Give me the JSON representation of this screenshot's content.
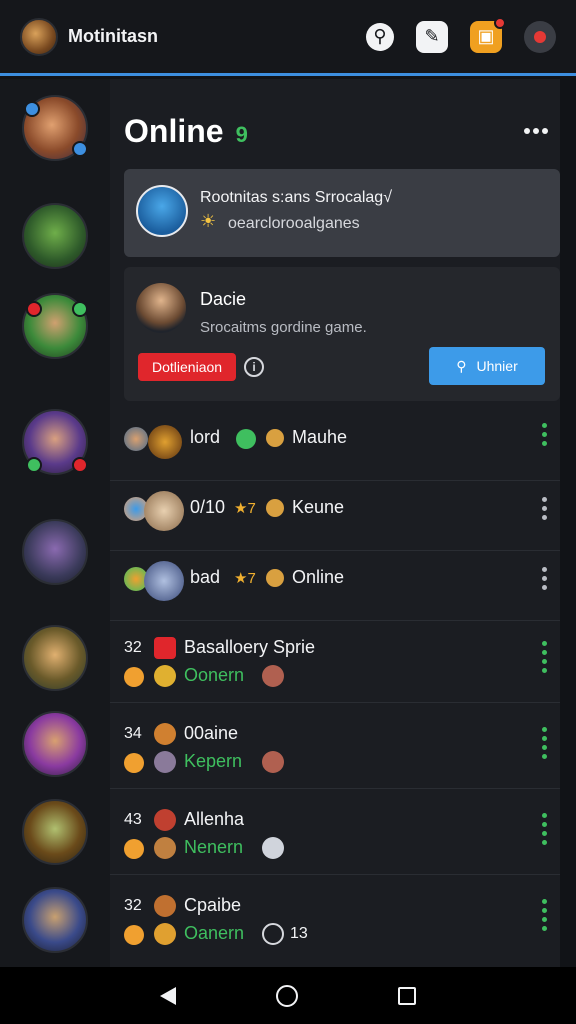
{
  "header": {
    "title": "Motinitasn",
    "icons": [
      "search-icon",
      "edit-icon",
      "notification-icon",
      "profile-icon"
    ]
  },
  "main": {
    "heading": "Online",
    "online_count": "9"
  },
  "card_status": {
    "line1": "Rootnitas s:ans Srrocalag√",
    "line2": "oearclorooalganes"
  },
  "card_invite": {
    "name": "Dacie",
    "description": "Srocaitms gordine game.",
    "tag_label": "Dotlieniaon",
    "info_label": "i",
    "join_label": "Uhnier"
  },
  "rows": [
    {
      "text_a": "lord",
      "text_b": "Mauhe"
    },
    {
      "text_a": "0/10",
      "star": "★7",
      "text_b": "Keune"
    },
    {
      "text_a": "bad",
      "star": "★7",
      "text_b": "Online"
    },
    {
      "num": "32",
      "title": "Basalloery Sprie",
      "status": "Oonern"
    },
    {
      "num": "34",
      "title": "00aine",
      "status": "Kepern"
    },
    {
      "num": "43",
      "title": "Allenha",
      "status": "Nenern"
    },
    {
      "num": "32",
      "title": "Cpaibe",
      "status": "Oanern",
      "extra": "13"
    }
  ],
  "colors": {
    "accent_blue": "#3d8fe0",
    "online_green": "#3fbf5f",
    "danger_red": "#e0262c",
    "join_blue": "#3d9be9"
  }
}
